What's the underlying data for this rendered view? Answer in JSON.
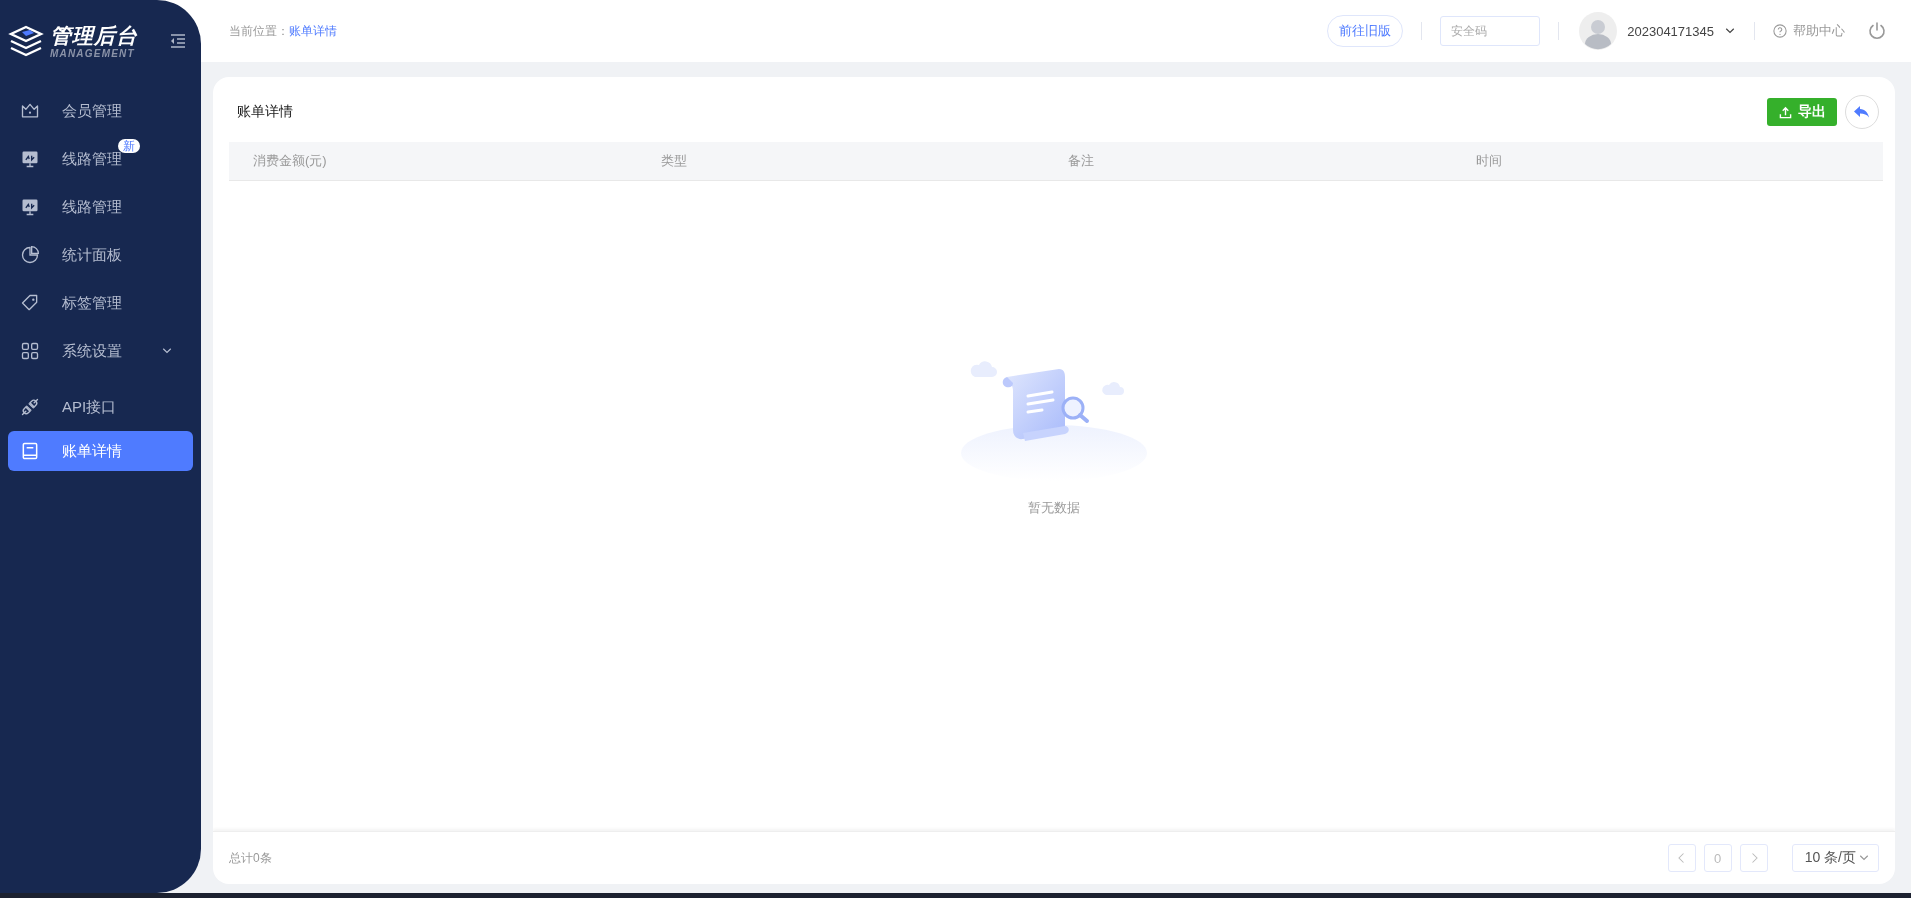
{
  "logo": {
    "title": "管理后台",
    "subtitle": "MANAGEMENT"
  },
  "sidebar": {
    "items": [
      {
        "kind": "crown",
        "label": "会员管理",
        "selected": false,
        "submenu": false
      },
      {
        "kind": "monitor",
        "label": "线路管理",
        "badge": "新",
        "selected": false,
        "submenu": false
      },
      {
        "kind": "monitor",
        "label": "线路管理",
        "selected": false,
        "submenu": false
      },
      {
        "kind": "pie",
        "label": "统计面板",
        "selected": false,
        "submenu": false
      },
      {
        "kind": "tag",
        "label": "标签管理",
        "selected": false,
        "submenu": false
      },
      {
        "kind": "grid",
        "label": "系统设置",
        "selected": false,
        "submenu": true
      },
      {
        "kind": "plug",
        "label": "API接口",
        "selected": false,
        "submenu": false
      },
      {
        "kind": "book",
        "label": "账单详情",
        "selected": true,
        "submenu": false
      }
    ]
  },
  "header": {
    "breadcrumb_label": "当前位置：",
    "breadcrumb_current": "账单详情",
    "old_version_button": "前往旧版",
    "security_field": {
      "placeholder": "安全码"
    },
    "user": "202304171345",
    "help": "帮助中心"
  },
  "card": {
    "title": "账单详情",
    "export_button": "导出",
    "table": {
      "columns": [
        "消费金额(元)",
        "类型",
        "备注",
        "时间"
      ],
      "empty_text": "暂无数据"
    },
    "footer": {
      "total": "总计0条",
      "page": "0",
      "page_size": "10 条/页"
    }
  }
}
